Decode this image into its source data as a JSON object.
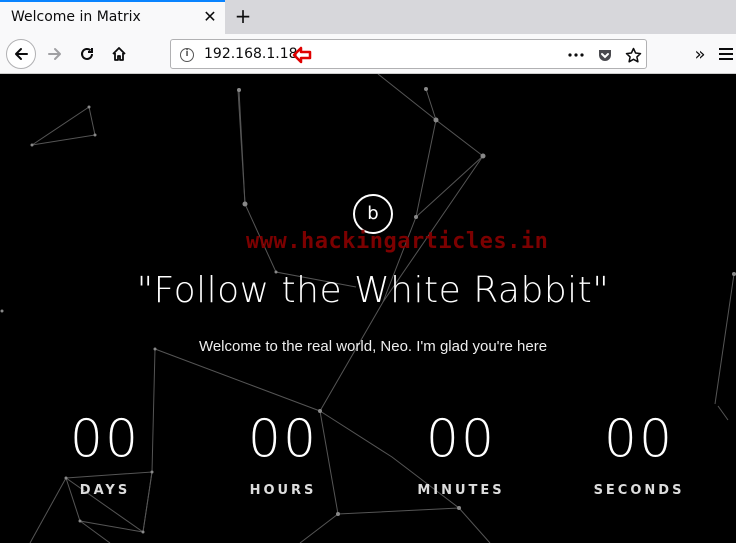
{
  "tab": {
    "title": "Welcome in Matrix"
  },
  "urlbar": {
    "url": "192.168.1.18"
  },
  "page": {
    "logo_letter": "b",
    "watermark": "www.hackingarticles.in",
    "headline": "\"Follow the White Rabbit\"",
    "subtitle": "Welcome to the real world, Neo. I'm glad you're here"
  },
  "countdown": [
    {
      "value": "00",
      "label": "DAYS"
    },
    {
      "value": "00",
      "label": "HOURS"
    },
    {
      "value": "00",
      "label": "MINUTES"
    },
    {
      "value": "00",
      "label": "SECONDS"
    }
  ],
  "icons": {
    "tab_close": "close-icon",
    "new_tab": "plus-icon",
    "back": "arrow-left-icon",
    "forward": "arrow-right-icon",
    "reload": "reload-icon",
    "home": "home-icon",
    "site_info": "info-icon",
    "page_actions": "more-icon",
    "pocket": "pocket-icon",
    "bookmark": "star-icon",
    "overflow": "chevrons-right-icon",
    "menu": "hamburger-icon"
  },
  "colors": {
    "tab_accent": "#0a84ff",
    "marker": "#e00000",
    "background": "#000000"
  }
}
